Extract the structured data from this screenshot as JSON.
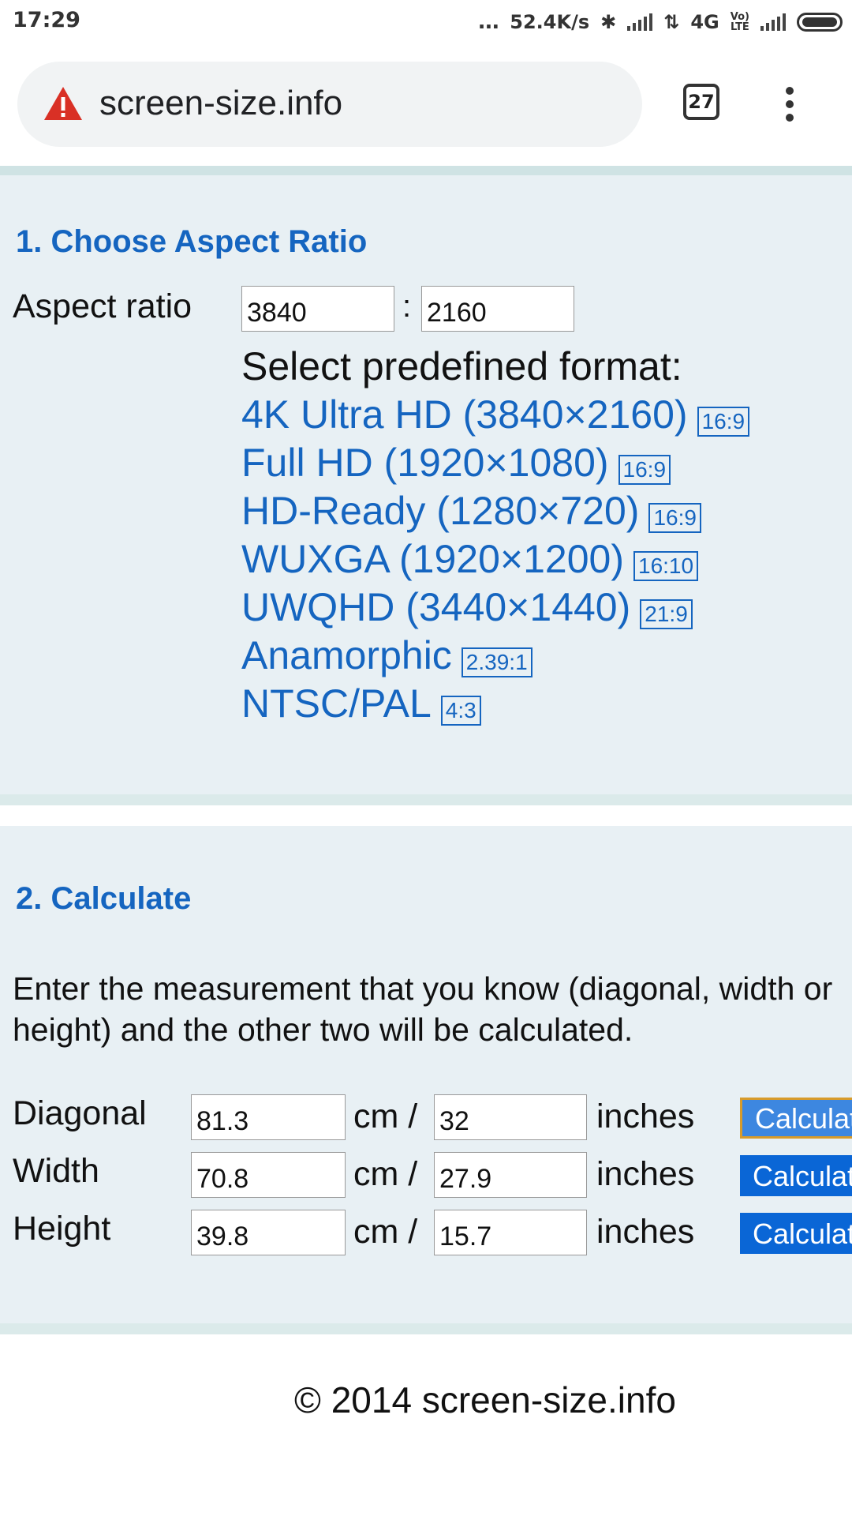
{
  "status_bar": {
    "time": "17:29",
    "dots": "...",
    "speed": "52.4K/s",
    "network": "4G",
    "volte_top": "Vo)",
    "volte_bottom": "LTE"
  },
  "browser": {
    "url": "screen-size.info",
    "tab_count": "27",
    "icons": [
      "warning-icon",
      "tab-switcher-icon",
      "more-menu-icon"
    ]
  },
  "section1": {
    "title": "1. Choose Aspect Ratio",
    "aspect_label": "Aspect ratio",
    "aspect_w": "3840",
    "aspect_h": "2160",
    "separator": ":",
    "formats_heading": "Select predefined format:",
    "formats": [
      {
        "label": "4K Ultra HD (3840×2160)",
        "ratio": "16:9"
      },
      {
        "label": "Full HD (1920×1080)",
        "ratio": "16:9"
      },
      {
        "label": "HD-Ready (1280×720)",
        "ratio": "16:9"
      },
      {
        "label": "WUXGA (1920×1200)",
        "ratio": "16:10"
      },
      {
        "label": "UWQHD (3440×1440)",
        "ratio": "21:9"
      },
      {
        "label": "Anamorphic",
        "ratio": "2.39:1"
      },
      {
        "label": "NTSC/PAL",
        "ratio": "4:3"
      }
    ]
  },
  "section2": {
    "title": "2. Calculate",
    "description": "Enter the measurement that you know (diagonal, width or height) and the other two will be calculated.",
    "rows": [
      {
        "label": "Diagonal",
        "cm": "81.3",
        "cm_unit": "cm /",
        "inches": "32",
        "in_unit": "inches",
        "button": "Calculate"
      },
      {
        "label": "Width",
        "cm": "70.8",
        "cm_unit": "cm /",
        "inches": "27.9",
        "in_unit": "inches",
        "button": "Calculate"
      },
      {
        "label": "Height",
        "cm": "39.8",
        "cm_unit": "cm /",
        "inches": "15.7",
        "in_unit": "inches",
        "button": "Calculate"
      }
    ]
  },
  "footer": "© 2014 screen-size.info",
  "colors": {
    "link": "#1565c0",
    "button": "#0a66d6",
    "section_bg": "#e8f0f4",
    "warning": "#d93025"
  }
}
